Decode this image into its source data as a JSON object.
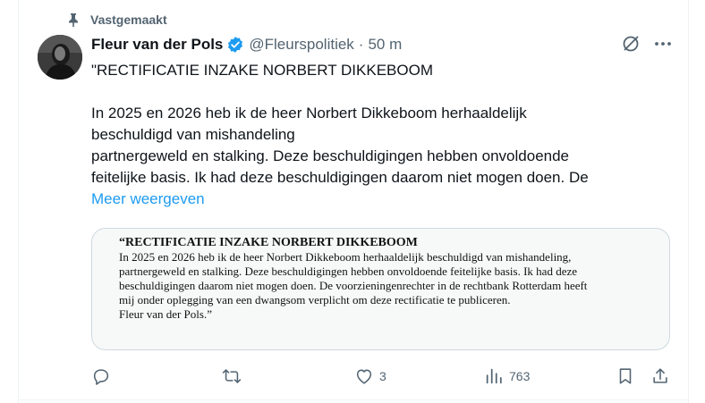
{
  "pinned": {
    "label": "Vastgemaakt",
    "icon": "pin-icon"
  },
  "author": {
    "name": "Fleur van der Pols",
    "handle": "@Fleurspolitiek",
    "separator": "·",
    "time": "50 m",
    "verified_color": "#1d9bf0"
  },
  "tweet": {
    "line1": "\"RECTIFICATIE INZAKE NORBERT DIKKEBOOM",
    "line2": "In 2025 en 2026 heb ik de heer Norbert Dikkeboom herhaaldelijk",
    "line3": "beschuldigd van mishandeling",
    "line4": "partnergeweld en stalking. Deze beschuldigingen hebben onvoldoende",
    "line5": "feitelijke basis. Ik had deze beschuldigingen daarom niet mogen doen. De",
    "show_more": "Meer weergeven"
  },
  "media": {
    "title": "“RECTIFICATIE INZAKE NORBERT DIKKEBOOM",
    "lines": [
      "In 2025 en 2026 heb ik de heer Norbert Dikkeboom herhaaldelijk beschuldigd van mishandeling,",
      "partnergeweld en stalking. Deze beschuldigingen hebben onvoldoende feitelijke basis. Ik had deze",
      "beschuldigingen daarom niet mogen doen. De voorzieningenrechter in de rechtbank Rotterdam heeft",
      "mij onder oplegging van een dwangsom verplicht om deze rectificatie te publiceren.",
      "Fleur van der Pols.”"
    ]
  },
  "actions": {
    "reply_count": "",
    "retweet_count": "",
    "like_count": "3",
    "views_count": "763"
  },
  "colors": {
    "accent": "#1d9bf0",
    "muted": "#536471",
    "text": "#0f1419"
  }
}
